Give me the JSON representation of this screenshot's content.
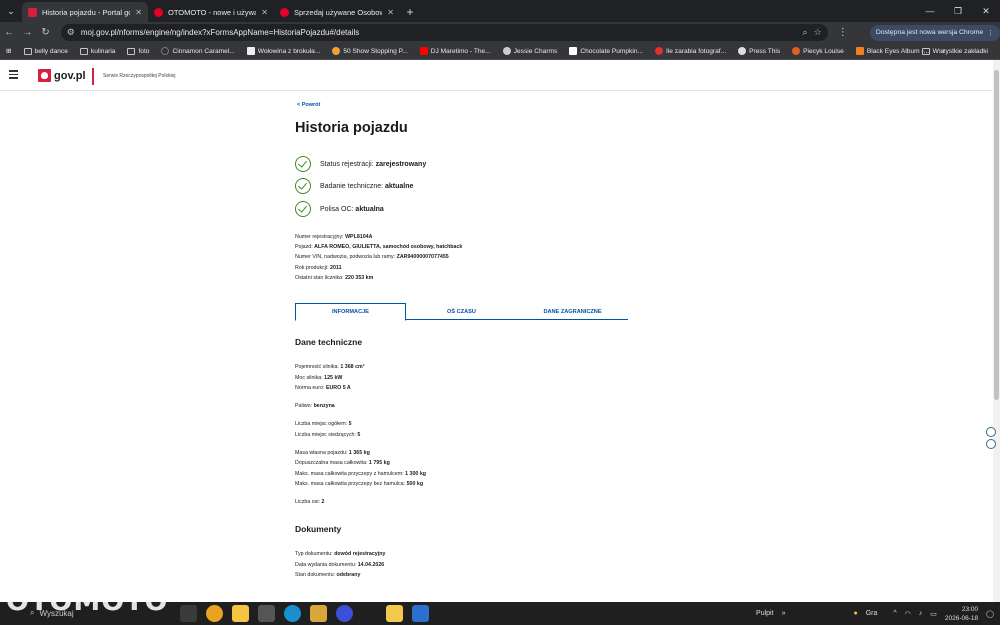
{
  "browser": {
    "tabs": [
      {
        "title": "Historia pojazdu - Portal gov.pl",
        "active": true,
        "fav_color": "#d4213d"
      },
      {
        "title": "OTOMOTO - nowe i używane sa",
        "active": false,
        "fav_color": "#e4002b"
      },
      {
        "title": "Sprzedaj używane Osobowe | O",
        "active": false,
        "fav_color": "#e4002b"
      }
    ],
    "url": "moj.gov.pl/nforms/engine/ng/index?xFormsAppName=HistoriaPojazdu#/details",
    "update_label": "Dostępna jest nowa wersja Chrome",
    "bookmarks": [
      {
        "label": "belly dance",
        "kind": "folder"
      },
      {
        "label": "kulinaria",
        "kind": "folder"
      },
      {
        "label": "foto",
        "kind": "folder"
      },
      {
        "label": "Cinnamon Caramel...",
        "kind": "site",
        "color": "#333333"
      },
      {
        "label": "Wołowina z brokuła...",
        "kind": "site",
        "color": "#eeeeee"
      },
      {
        "label": "50 Show Stopping P...",
        "kind": "site",
        "color": "#f0a030"
      },
      {
        "label": "DJ Maretimo - The...",
        "kind": "site",
        "color": "#ff0000"
      },
      {
        "label": "Jessie Charms",
        "kind": "site",
        "color": "#cccccc"
      },
      {
        "label": "Chocolate Pumpkin...",
        "kind": "site",
        "color": "#ffffff"
      },
      {
        "label": "Ile zarabia fotograf...",
        "kind": "site",
        "color": "#e03030"
      },
      {
        "label": "Press This",
        "kind": "site",
        "color": "#dddddd"
      },
      {
        "label": "Piecyk Louise",
        "kind": "site",
        "color": "#e06020"
      },
      {
        "label": "Black Eyes Album -...",
        "kind": "site",
        "color": "#f08020"
      }
    ],
    "all_bookmarks_label": "Wszystkie zakładki"
  },
  "site": {
    "logo_text": "gov.pl",
    "logo_subtitle": "Serwis Rzeczypospolitej Polskiej"
  },
  "page": {
    "back_label": "< Powrót",
    "title": "Historia pojazdu",
    "statuses": [
      {
        "label": "Status rejestracji:",
        "value": "zarejestrowany"
      },
      {
        "label": "Badanie techniczne:",
        "value": "aktualne"
      },
      {
        "label": "Polisa OC:",
        "value": "aktualna"
      }
    ],
    "vehicle_info": [
      {
        "label": "Numer rejestracyjny:",
        "value": "WPL8104A"
      },
      {
        "label": "Pojazd:",
        "value": "ALFA ROMEO, GIULIETTA, samochód osobowy, hatchback"
      },
      {
        "label": "Numer VIN, nadwozia, podwozia lub ramy:",
        "value": "ZAR94000007077455"
      },
      {
        "label": "Rok produkcji:",
        "value": "2011"
      },
      {
        "label": "Ostatni stan licznika:",
        "value": "220 353 km"
      }
    ],
    "tabs": [
      {
        "label": "INFORMACJE",
        "active": true
      },
      {
        "label": "OŚ CZASU",
        "active": false
      },
      {
        "label": "DANE ZAGRANICZNE",
        "active": false
      }
    ],
    "tech_title": "Dane techniczne",
    "tech_groups": [
      [
        {
          "label": "Pojemność silnika:",
          "value": "1 368 cm³"
        },
        {
          "label": "Moc silnika:",
          "value": "125 kW"
        },
        {
          "label": "Norma euro:",
          "value": "EURO 5 A"
        }
      ],
      [
        {
          "label": "Paliwo:",
          "value": "benzyna"
        }
      ],
      [
        {
          "label": "Liczba miejsc ogółem:",
          "value": "5"
        },
        {
          "label": "Liczba miejsc siedzących:",
          "value": "5"
        }
      ],
      [
        {
          "label": "Masa własna pojazdu:",
          "value": "1 365 kg"
        },
        {
          "label": "Dopuszczalna masa całkowita:",
          "value": "1 795 kg"
        },
        {
          "label": "Maks. masa całkowita przyczepy z hamulcem:",
          "value": "1 300 kg"
        },
        {
          "label": "Maks. masa całkowita przyczepy bez hamulca:",
          "value": "500 kg"
        }
      ],
      [
        {
          "label": "Liczba osi:",
          "value": "2"
        }
      ]
    ],
    "docs_title": "Dokumenty",
    "docs": [
      {
        "label": "Typ dokumentu:",
        "value": "dowód rejestracyjny"
      },
      {
        "label": "Data wydania dokumentu:",
        "value": "14.04.2026"
      },
      {
        "label": "Stan dokumentu:",
        "value": "odebrany"
      }
    ]
  },
  "taskbar": {
    "watermark": "OTOMOTO",
    "search_label": "Wyszukaj",
    "desktop_label": "Pulpit",
    "weather_label": "Gra",
    "time": "23:00",
    "date": "2026-06-18"
  }
}
